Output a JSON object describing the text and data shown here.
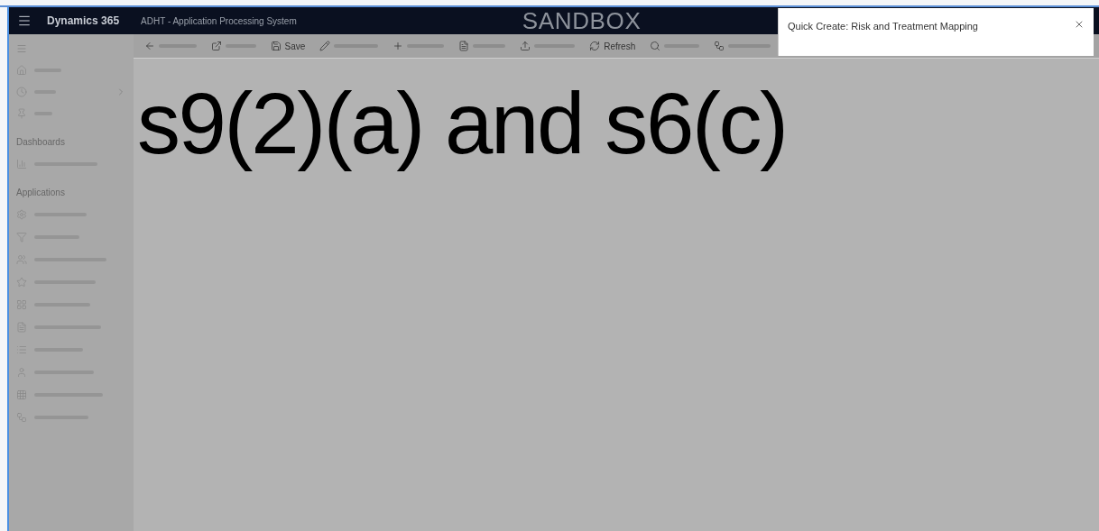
{
  "header": {
    "app_name": "Dynamics 365",
    "system_name": "ADHT - Application Processing System",
    "environment": "SANDBOX"
  },
  "toolbar": {
    "save_label": "Save",
    "refresh_label": "Refresh"
  },
  "sidebar": {
    "sections": [
      {
        "title": "Dashboards"
      },
      {
        "title": "Applications"
      }
    ]
  },
  "redaction": {
    "text": "s9(2)(a) and s6(c)"
  },
  "quick_create": {
    "title": "Quick Create: Risk and Treatment Mapping"
  }
}
